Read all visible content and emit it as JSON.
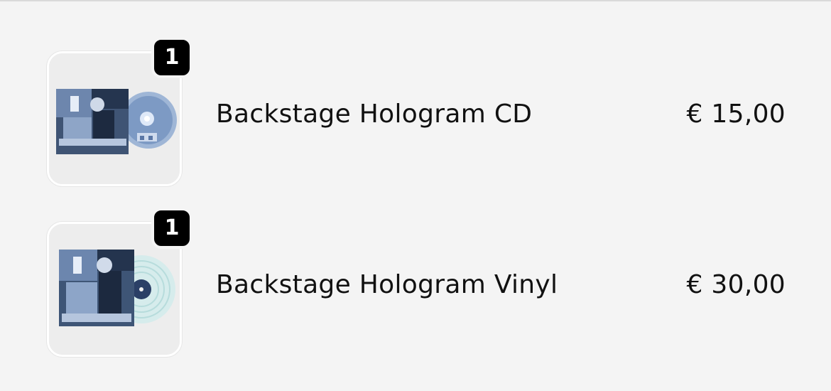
{
  "cart": {
    "items": [
      {
        "quantity": "1",
        "name": "Backstage Hologram CD",
        "price": "€ 15,00",
        "thumbnail_icon": "cd-album-cover-icon"
      },
      {
        "quantity": "1",
        "name": "Backstage Hologram Vinyl",
        "price": "€ 30,00",
        "thumbnail_icon": "vinyl-album-cover-icon"
      }
    ]
  },
  "colors": {
    "background": "#f4f4f4",
    "badge": "#000000",
    "badge_text": "#ffffff",
    "text": "#111111"
  }
}
